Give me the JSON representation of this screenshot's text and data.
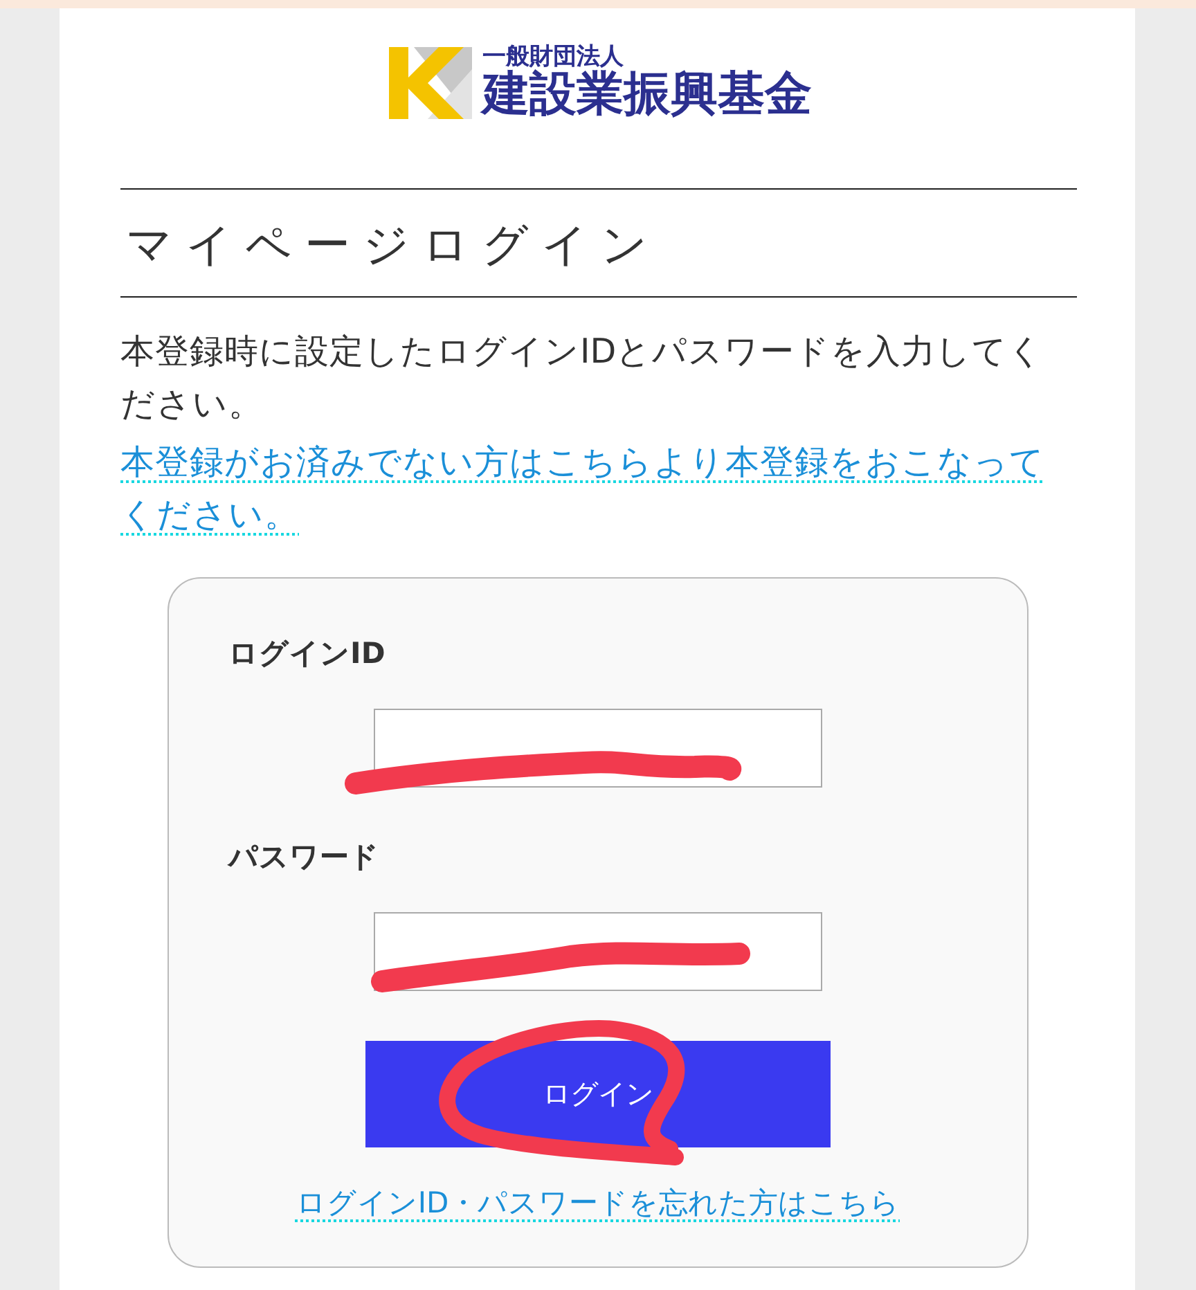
{
  "logo": {
    "subtitle": "一般財団法人",
    "name": "建設業振興基金"
  },
  "heading": "マイページログイン",
  "intro": "本登録時に設定したログインIDとパスワードを入力してください。",
  "register_link": "本登録がお済みでない方はこちらより本登録をおこなってください。",
  "form": {
    "fields": [
      {
        "label": "ログインID"
      },
      {
        "label": "パスワード"
      }
    ],
    "submit": "ログイン",
    "forgot_link": "ログインID・パスワードを忘れた方はこちら"
  }
}
